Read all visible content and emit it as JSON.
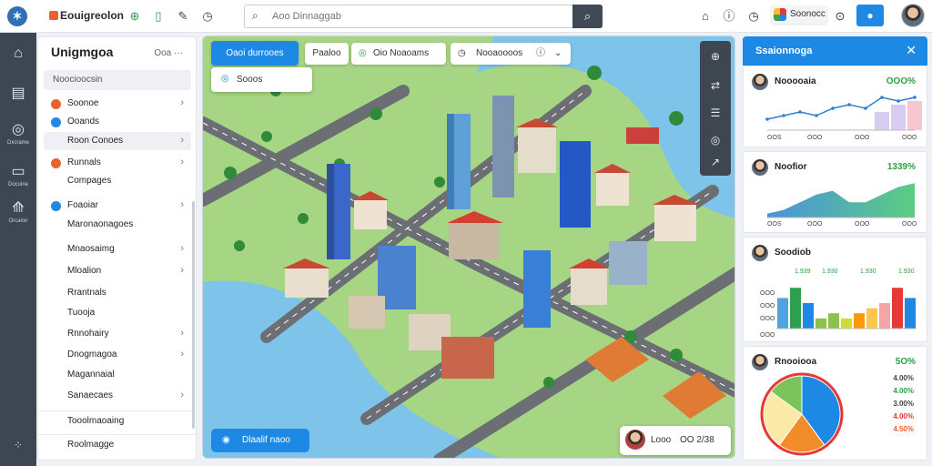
{
  "app": {
    "brand": "Eouigreolon",
    "search_placeholder": "Aoo Dinnaggab",
    "badge_text": "Soonocc"
  },
  "rail": {
    "items": [
      {
        "icon": "home-icon",
        "glyph": "⌂",
        "label": ""
      },
      {
        "icon": "layers-icon",
        "glyph": "▤",
        "label": ""
      },
      {
        "icon": "globe-icon",
        "glyph": "◎",
        "label": "Dxcrame"
      },
      {
        "icon": "document-icon",
        "glyph": "▭",
        "label": "Docuine"
      },
      {
        "icon": "road-icon",
        "glyph": "⟰",
        "label": "Orcalon"
      }
    ]
  },
  "sidebar": {
    "title": "Unigmgoa",
    "toggle": "Ooa ···",
    "search_text": "Noocioocsin",
    "items": [
      {
        "label": "Soonoe",
        "dot": "#e8642c",
        "chevron": true,
        "active": false
      },
      {
        "label": "Ooands",
        "dot": "#1e88e5",
        "chevron": false,
        "active": false
      },
      {
        "label": "Roon Conoes",
        "dot": "",
        "chevron": true,
        "active": true
      },
      {
        "label": "Runnals",
        "dot": "#e8642c",
        "chevron": true,
        "active": false
      },
      {
        "label": "Compages",
        "dot": "",
        "chevron": false,
        "active": false
      },
      {
        "label": "Foaoiar",
        "dot": "#1e88e5",
        "chevron": true,
        "active": false
      },
      {
        "label": "Maronaonagoes",
        "dot": "",
        "chevron": false,
        "active": false
      },
      {
        "label": "Mnaosaimg",
        "dot": "",
        "chevron": true,
        "active": false
      },
      {
        "label": "Mloalion",
        "dot": "",
        "chevron": true,
        "active": false
      },
      {
        "label": "Rrantnals",
        "dot": "",
        "chevron": false,
        "active": false
      },
      {
        "label": "Tuooja",
        "dot": "",
        "chevron": false,
        "active": false
      },
      {
        "label": "Rnnohairy",
        "dot": "",
        "chevron": true,
        "active": false
      },
      {
        "label": "Dnogmagoa",
        "dot": "",
        "chevron": true,
        "active": false
      },
      {
        "label": "Magannaial",
        "dot": "",
        "chevron": false,
        "active": false
      },
      {
        "label": "Sanaecaes",
        "dot": "",
        "chevron": true,
        "active": false
      }
    ],
    "footer_items": [
      "Tooolmaoaing",
      "Roolmagge"
    ]
  },
  "map": {
    "tab_primary": "Oaoi durrooes",
    "tabs": [
      "Paaloo",
      "Oio Noaoams",
      "Nooaoooos"
    ],
    "dropdown_item": "Sooos",
    "chip": "Dlaalif naoo",
    "user_name": "Looo",
    "user_count": "OO 2/38"
  },
  "panel": {
    "title": "Ssaionnoga",
    "cards": [
      {
        "name": "Nooooaia",
        "value": "OOO%",
        "ticks": [
          "OOS",
          "OOO",
          "OOO",
          "OOO"
        ]
      },
      {
        "name": "Noofior",
        "value": "1339%",
        "ticks": [
          "OOS",
          "OOO",
          "OOO",
          "OOO"
        ]
      },
      {
        "name": "Soodiob",
        "value": "",
        "ticks": [
          "OOS",
          "OOO",
          "OOO",
          "OOO"
        ],
        "top_ticks": [
          "1.939",
          "1.930",
          "1.930",
          "1.930"
        ],
        "left_ticks": [
          "OOO",
          "OOO",
          "OOO",
          "OOO"
        ]
      },
      {
        "name": "Rnooiooa",
        "value": "5O%",
        "legend": [
          "4.00%",
          "4.00%",
          "3.00%",
          "4.00%",
          "4.50%"
        ]
      }
    ]
  },
  "chart_data": [
    {
      "type": "line",
      "x": [
        0,
        1,
        2,
        3,
        4,
        5,
        6,
        7,
        8,
        9
      ],
      "series": [
        {
          "values": [
            3,
            4,
            5,
            4,
            6,
            7,
            6,
            9,
            8,
            9
          ]
        }
      ],
      "bars_overlay": [
        0,
        0,
        0,
        0,
        0,
        0,
        0,
        5,
        7,
        8
      ],
      "ylim": [
        0,
        10
      ]
    },
    {
      "type": "area",
      "x": [
        0,
        1,
        2,
        3,
        4,
        5,
        6,
        7,
        8,
        9
      ],
      "series": [
        {
          "values": [
            1,
            2,
            4,
            6,
            7,
            4,
            4,
            6,
            8,
            9
          ]
        }
      ],
      "ylim": [
        0,
        10
      ]
    },
    {
      "type": "bar",
      "values": [
        6,
        8,
        5,
        2,
        3,
        2,
        3,
        4,
        5,
        8,
        6
      ],
      "colors": [
        "#4fa3e0",
        "#2e9e4f",
        "#1e88e5",
        "#8bc34a",
        "#8bc34a",
        "#cddc39",
        "#ff9800",
        "#f9c74f",
        "#f4a6a6",
        "#e53935",
        "#1e88e5"
      ],
      "ylim": [
        0,
        10
      ]
    },
    {
      "type": "pie",
      "values": [
        40,
        20,
        25,
        15
      ],
      "colors": [
        "#1e88e5",
        "#f28c28",
        "#fbe9a8",
        "#7cc35a"
      ]
    }
  ],
  "colors": {
    "accent": "#1e88e5",
    "rail": "#3d4753",
    "positive": "#2ea043"
  }
}
